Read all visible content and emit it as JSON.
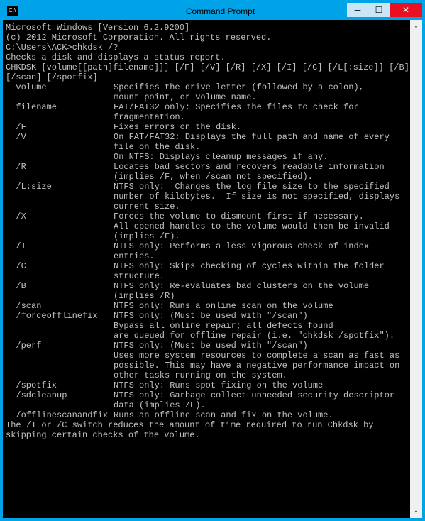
{
  "title": "Command Prompt",
  "icon_label": "C:\\",
  "header": [
    "Microsoft Windows [Version 6.2.9200]",
    "(c) 2012 Microsoft Corporation. All rights reserved."
  ],
  "prompt": "C:\\Users\\ACK>chkdsk /?",
  "summary": "Checks a disk and displays a status report.",
  "syntax": [
    "CHKDSK [volume[[path]filename]]] [/F] [/V] [/R] [/X] [/I] [/C] [/L[:size]] [/B]",
    "[/scan] [/spotfix]"
  ],
  "opts": [
    {
      "o": "  volume",
      "d": [
        "Specifies the drive letter (followed by a colon),",
        "mount point, or volume name."
      ]
    },
    {
      "o": "  filename",
      "d": [
        "FAT/FAT32 only: Specifies the files to check for",
        "fragmentation."
      ]
    },
    {
      "o": "  /F",
      "d": [
        "Fixes errors on the disk."
      ]
    },
    {
      "o": "  /V",
      "d": [
        "On FAT/FAT32: Displays the full path and name of every",
        "file on the disk.",
        "On NTFS: Displays cleanup messages if any."
      ]
    },
    {
      "o": "  /R",
      "d": [
        "Locates bad sectors and recovers readable information",
        "(implies /F, when /scan not specified)."
      ]
    },
    {
      "o": "  /L:size",
      "d": [
        "NTFS only:  Changes the log file size to the specified",
        "number of kilobytes.  If size is not specified, displays",
        "current size."
      ]
    },
    {
      "o": "  /X",
      "d": [
        "Forces the volume to dismount first if necessary.",
        "All opened handles to the volume would then be invalid",
        "(implies /F)."
      ]
    },
    {
      "o": "  /I",
      "d": [
        "NTFS only: Performs a less vigorous check of index",
        "entries."
      ]
    },
    {
      "o": "  /C",
      "d": [
        "NTFS only: Skips checking of cycles within the folder",
        "structure."
      ]
    },
    {
      "o": "  /B",
      "d": [
        "NTFS only: Re-evaluates bad clusters on the volume",
        "(implies /R)"
      ]
    },
    {
      "o": "  /scan",
      "d": [
        "NTFS only: Runs a online scan on the volume"
      ]
    },
    {
      "o": "  /forceofflinefix",
      "d": [
        "NTFS only: (Must be used with \"/scan\")",
        "Bypass all online repair; all defects found",
        "are queued for offline repair (i.e. \"chkdsk /spotfix\")."
      ]
    },
    {
      "o": "  /perf",
      "d": [
        "NTFS only: (Must be used with \"/scan\")",
        "Uses more system resources to complete a scan as fast as",
        "possible. This may have a negative performance impact on",
        "other tasks running on the system."
      ]
    },
    {
      "o": "  /spotfix",
      "d": [
        "NTFS only: Runs spot fixing on the volume"
      ]
    },
    {
      "o": "  /sdcleanup",
      "d": [
        "NTFS only: Garbage collect unneeded security descriptor",
        "data (implies /F)."
      ]
    },
    {
      "o": "  /offlinescanandfix",
      "d": [
        "Runs an offline scan and fix on the volume."
      ]
    }
  ],
  "footer": [
    "The /I or /C switch reduces the amount of time required to run Chkdsk by",
    "skipping certain checks of the volume."
  ]
}
